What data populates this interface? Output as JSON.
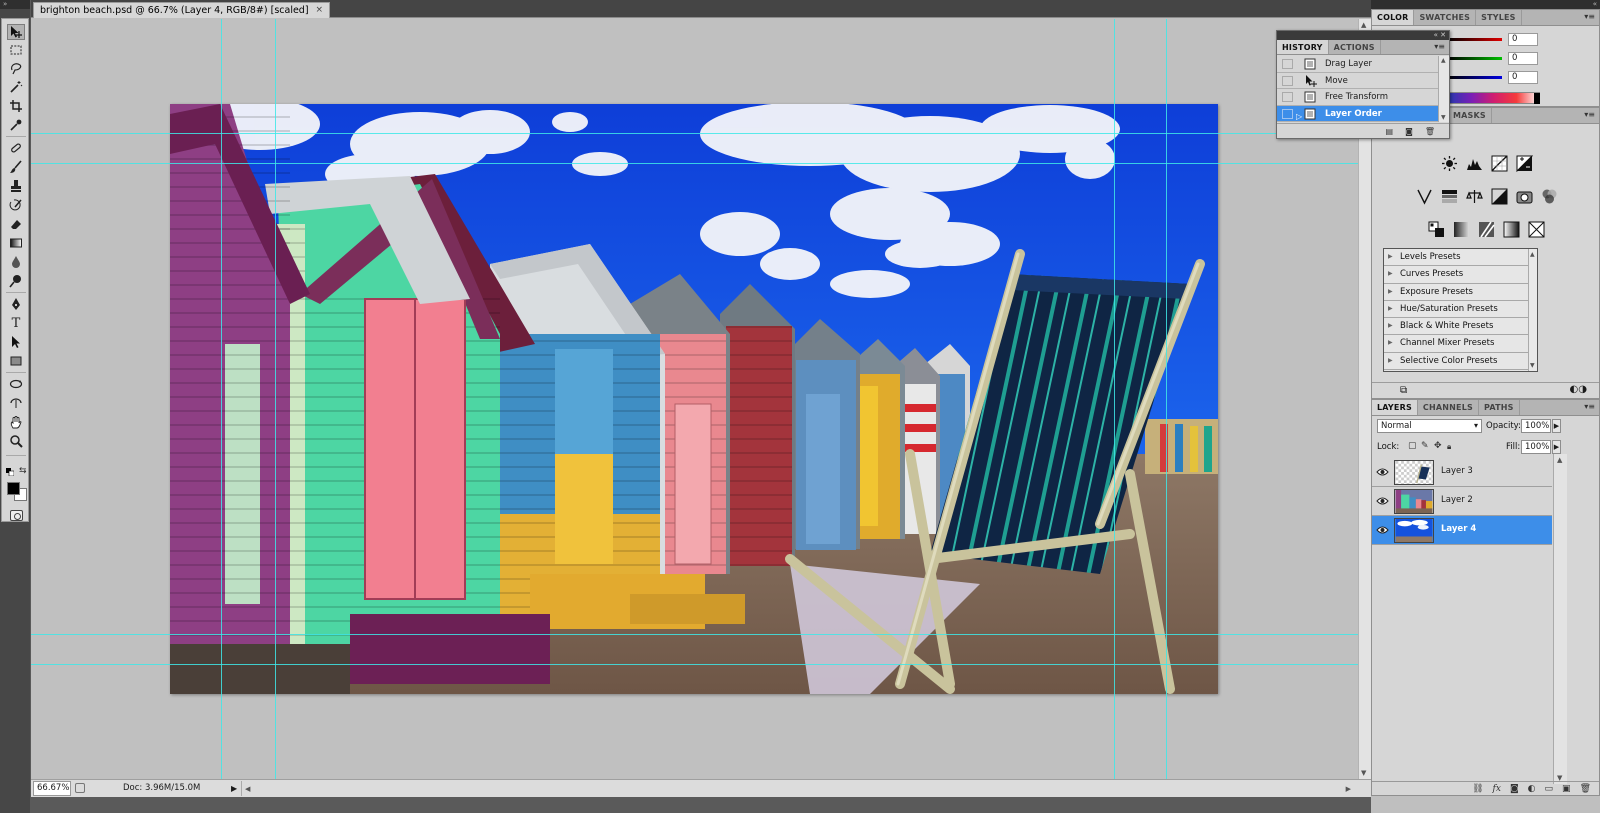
{
  "document": {
    "tab_title": "brighton beach.psd @ 66.7% (Layer 4, RGB/8#) [scaled]",
    "tab_close": "×",
    "zoom": "66.67%",
    "doc_info": "Doc: 3.96M/15.0M"
  },
  "toolbox": {
    "collapse_glyph": "»",
    "tools": [
      {
        "name": "move-tool"
      },
      {
        "name": "marquee-tool"
      },
      {
        "name": "lasso-tool"
      },
      {
        "name": "magic-wand-tool"
      },
      {
        "name": "crop-tool"
      },
      {
        "name": "eyedropper-tool"
      },
      {
        "name": "healing-brush-tool"
      },
      {
        "name": "brush-tool"
      },
      {
        "name": "clone-stamp-tool"
      },
      {
        "name": "history-brush-tool"
      },
      {
        "name": "eraser-tool"
      },
      {
        "name": "gradient-tool"
      },
      {
        "name": "blur-tool"
      },
      {
        "name": "dodge-tool"
      },
      {
        "name": "pen-tool"
      },
      {
        "name": "type-tool"
      },
      {
        "name": "path-selection-tool"
      },
      {
        "name": "shape-tool"
      },
      {
        "name": "3d-rotate-tool"
      },
      {
        "name": "3d-orbit-tool"
      },
      {
        "name": "hand-tool"
      },
      {
        "name": "zoom-tool"
      }
    ],
    "type_glyph": "T",
    "foreground_color": "#000000",
    "background_color": "#ffffff"
  },
  "panels": {
    "top_glyph": "«",
    "color": {
      "tabs": [
        "COLOR",
        "SWATCHES",
        "STYLES"
      ],
      "r": "0",
      "g": "0",
      "b": "0"
    },
    "adjustments": {
      "tab_fragment": "MASKS",
      "presets": [
        "Levels Presets",
        "Curves Presets",
        "Exposure Presets",
        "Hue/Saturation Presets",
        "Black & White Presets",
        "Channel Mixer Presets",
        "Selective Color Presets"
      ]
    },
    "layers": {
      "tabs": [
        "LAYERS",
        "CHANNELS",
        "PATHS"
      ],
      "blend_mode": "Normal",
      "opacity_label": "Opacity:",
      "opacity": "100%",
      "lock_label": "Lock:",
      "fill_label": "Fill:",
      "fill": "100%",
      "items": [
        {
          "name": "Layer 3",
          "selected": false
        },
        {
          "name": "Layer 2",
          "selected": false
        },
        {
          "name": "Layer 4",
          "selected": true
        }
      ],
      "footer_icons": [
        "link-icon",
        "fx-icon",
        "mask-icon",
        "adjustment-icon",
        "group-icon",
        "new-layer-icon",
        "trash-icon"
      ]
    },
    "history": {
      "tabs": [
        "HISTORY",
        "ACTIONS"
      ],
      "items": [
        {
          "label": "Drag Layer",
          "selected": false
        },
        {
          "label": "Move",
          "selected": false
        },
        {
          "label": "Free Transform",
          "selected": false
        },
        {
          "label": "Layer Order",
          "selected": true
        }
      ]
    }
  },
  "colors": {
    "accent": "#3d8ee9",
    "guide": "#3ee8e8",
    "canvas_bg": "#c0c0c0"
  }
}
